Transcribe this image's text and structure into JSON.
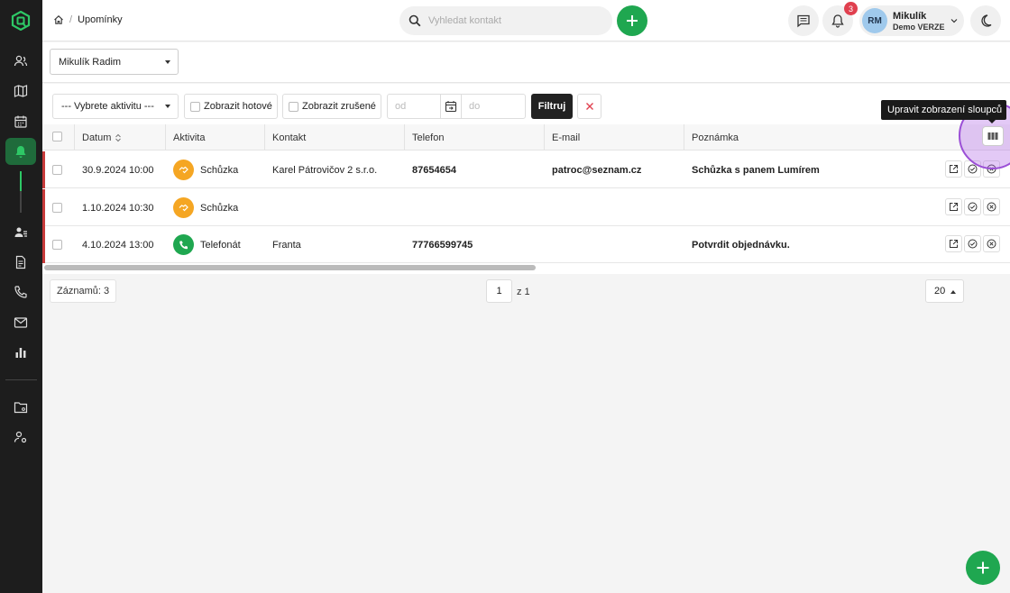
{
  "colors": {
    "accent": "#1fa750",
    "sidebar": "#1d1d1d",
    "meeting": "#f5a623",
    "call": "#1fa750",
    "alert": "#e0404f"
  },
  "header": {
    "breadcrumb": {
      "home_icon": "home-icon",
      "page": "Upomínky"
    },
    "search": {
      "placeholder": "Vyhledat kontakt"
    },
    "notifications_count": "3",
    "user": {
      "initials": "RM",
      "name": "Mikulík",
      "company": "Demo VERZE"
    }
  },
  "owner_select": {
    "value": "Mikulík Radim"
  },
  "filters": {
    "activity_select": "--- Vybrete aktivitu ---",
    "show_done": "Zobrazit hotové",
    "show_cancelled": "Zobrazit zrušené",
    "date_from_placeholder": "od",
    "date_to_placeholder": "do",
    "filter_button": "Filtruj",
    "tooltip": "Upravit zobrazení sloupců"
  },
  "table": {
    "columns": [
      "Datum",
      "Aktivita",
      "Kontakt",
      "Telefon",
      "E-mail",
      "Poznámka"
    ],
    "rows": [
      {
        "date": "30.9.2024 10:00",
        "activity": "Schůzka",
        "activity_icon": "meeting-icon",
        "contact": "Karel Pátrovičov 2 s.r.o.",
        "phone": "87654654",
        "email": "patroc@seznam.cz",
        "note": "Schůzka s panem Lumírem"
      },
      {
        "date": "1.10.2024 10:30",
        "activity": "Schůzka",
        "activity_icon": "meeting-icon",
        "contact": "",
        "phone": "",
        "email": "",
        "note": ""
      },
      {
        "date": "4.10.2024 13:00",
        "activity": "Telefonát",
        "activity_icon": "phone-icon",
        "contact": "Franta",
        "phone": "77766599745",
        "email": "",
        "note": "Potvrdit objednávku."
      }
    ]
  },
  "footer": {
    "records_label": "Záznamů: 3",
    "page": "1",
    "page_of": "z 1",
    "per_page": "20"
  }
}
